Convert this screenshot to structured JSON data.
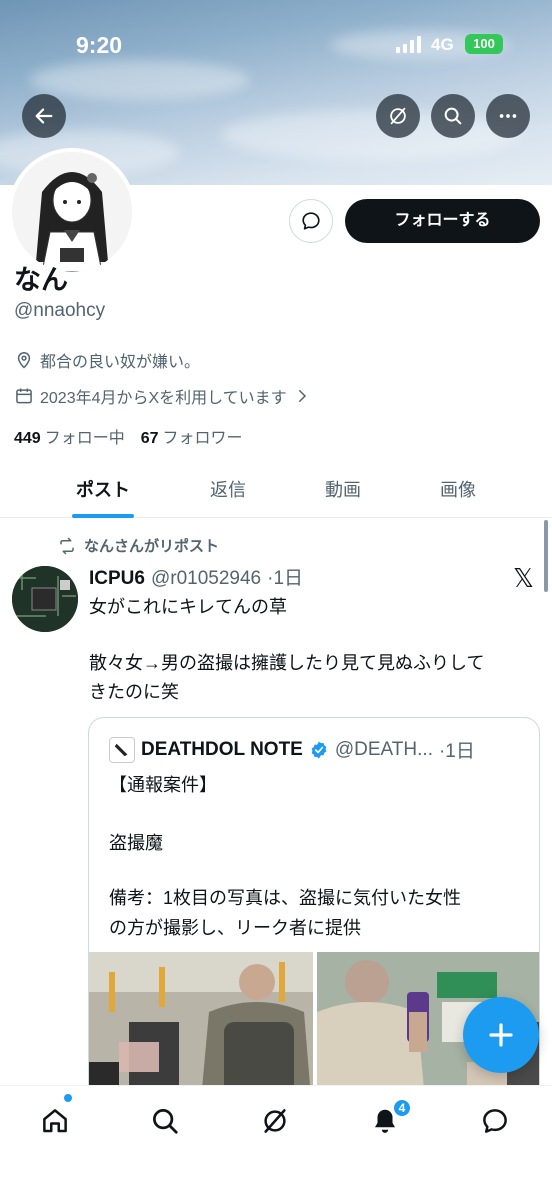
{
  "status_bar": {
    "time": "9:20",
    "network": "4G",
    "battery": "100"
  },
  "header": {
    "back_icon": "arrow-left-icon",
    "grok_icon": "grok-icon",
    "search_icon": "search-icon",
    "more_icon": "ellipsis-icon"
  },
  "profile": {
    "display_name": "なん",
    "handle": "@nnaohcy",
    "bio": "都合の良い奴が嫌い。",
    "joined": "2023年4月からXを利用しています",
    "following_count": "449",
    "following_label": "フォロー中",
    "followers_count": "67",
    "followers_label": "フォロワー",
    "follow_button": "フォローする"
  },
  "tabs": [
    {
      "label": "ポスト",
      "active": true
    },
    {
      "label": "返信",
      "active": false
    },
    {
      "label": "動画",
      "active": false
    },
    {
      "label": "画像",
      "active": false
    }
  ],
  "post": {
    "repost_label": "なんさんがリポスト",
    "author_name": "ICPU6",
    "author_handle": "@r01052946",
    "time": "·1日",
    "text_line1": "女がこれにキレてんの草",
    "text_line2": "散々女→男の盗撮は擁護したり見て見ぬふりして",
    "text_line3": "きたのに笑",
    "quote": {
      "author_name": "DEATHDOL NOTE",
      "author_handle": "@DEATH...",
      "time": "·1日",
      "line1": "【通報案件】",
      "line2": "盗撮魔",
      "line3": "備考：1枚目の写真は、盗撮に気付いた女性",
      "line4": "の方が撮影し、リーク者に提供"
    }
  },
  "bottom_nav": {
    "items": [
      "home-icon",
      "search-icon",
      "grok-icon",
      "notifications-icon",
      "messages-icon"
    ],
    "notification_count": "4"
  },
  "colors": {
    "accent": "#1d9bf0",
    "text": "#0f1419",
    "secondary": "#536471",
    "verified": "#1d9bf0"
  }
}
